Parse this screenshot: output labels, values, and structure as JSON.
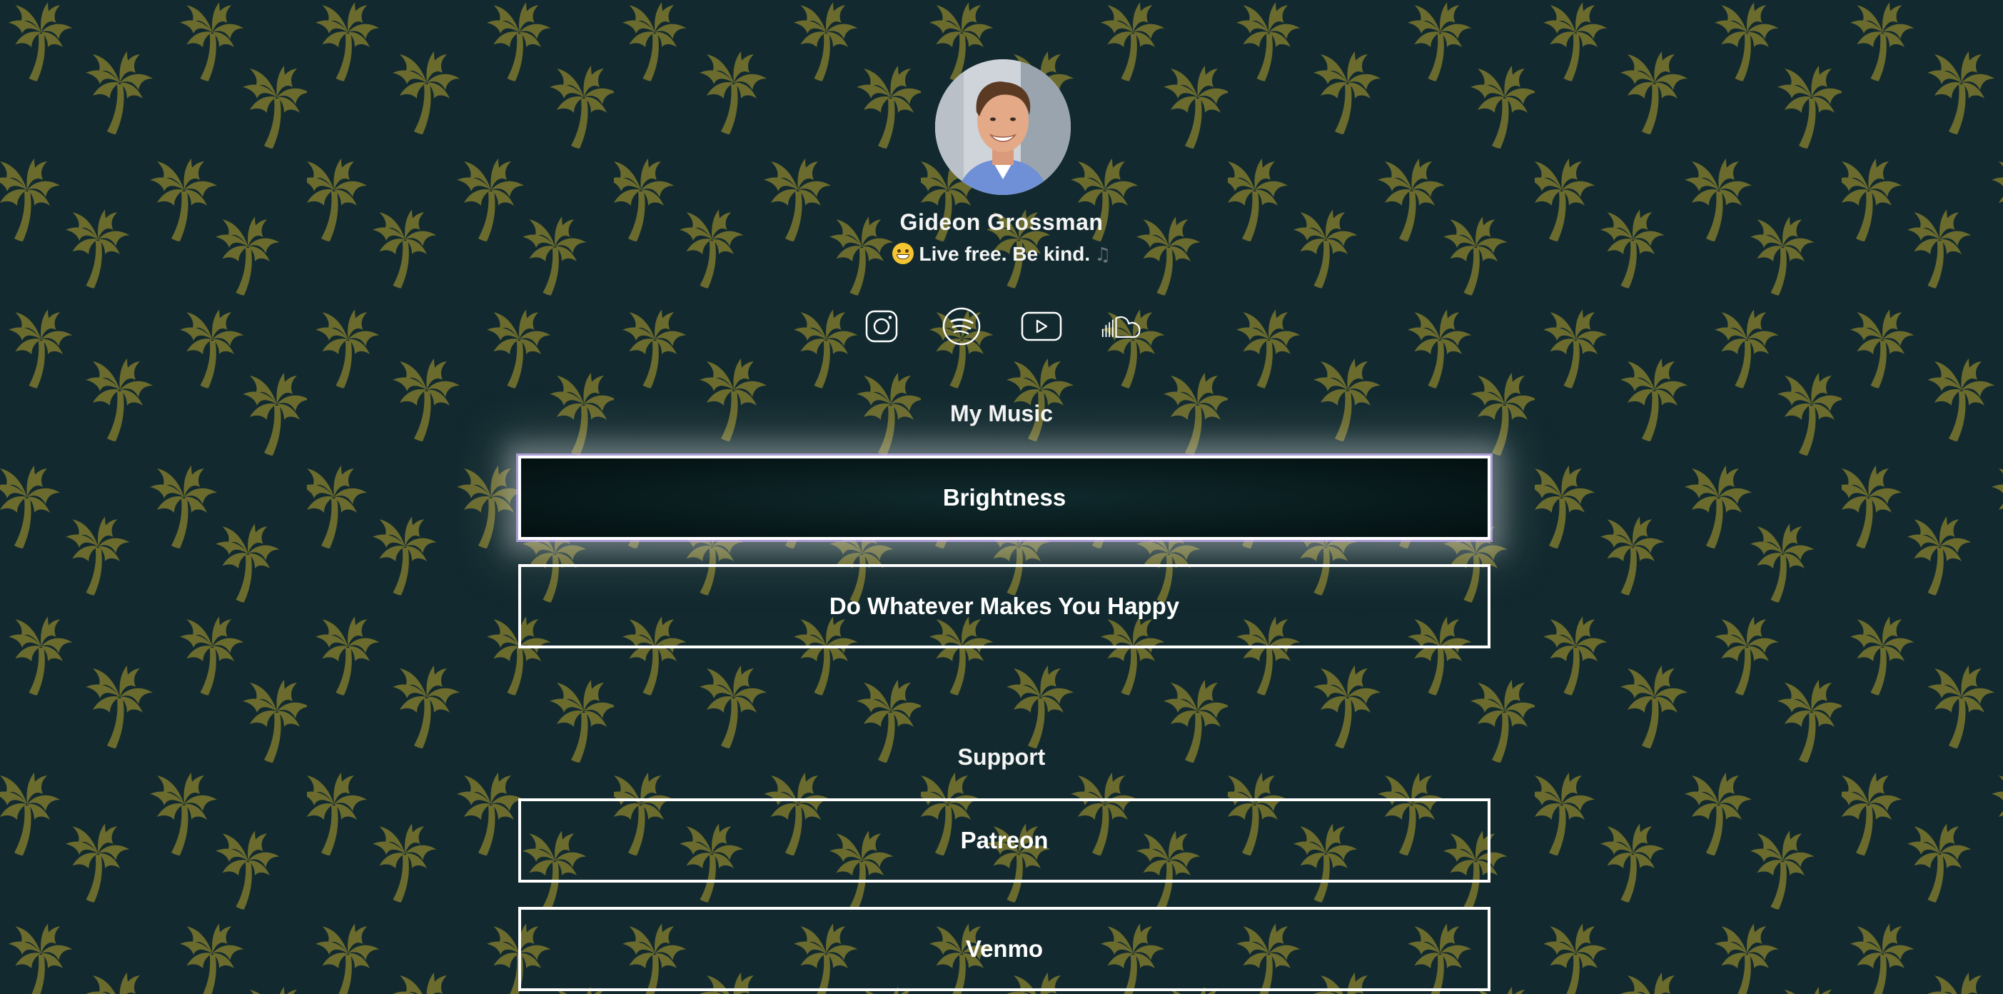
{
  "profile": {
    "name": "Gideon Grossman",
    "bio": "Live free. Be kind.",
    "bio_emoji": "grinning-face",
    "bio_trailing_icon": "musical-note"
  },
  "socials": [
    {
      "name": "instagram-icon"
    },
    {
      "name": "spotify-icon"
    },
    {
      "name": "youtube-icon"
    },
    {
      "name": "soundcloud-icon"
    }
  ],
  "sections": [
    {
      "title": "My Music",
      "links": [
        {
          "label": "Brightness",
          "featured": true
        },
        {
          "label": "Do Whatever Makes You Happy",
          "featured": false
        }
      ]
    },
    {
      "title": "Support",
      "links": [
        {
          "label": "Patreon",
          "featured": false
        },
        {
          "label": "Venmo",
          "featured": false
        }
      ]
    }
  ],
  "theme": {
    "background": "#122a2f",
    "pattern_color": "#6b6b2e",
    "button_border": "#ffffff",
    "featured_glow": "#cdb4ff"
  }
}
